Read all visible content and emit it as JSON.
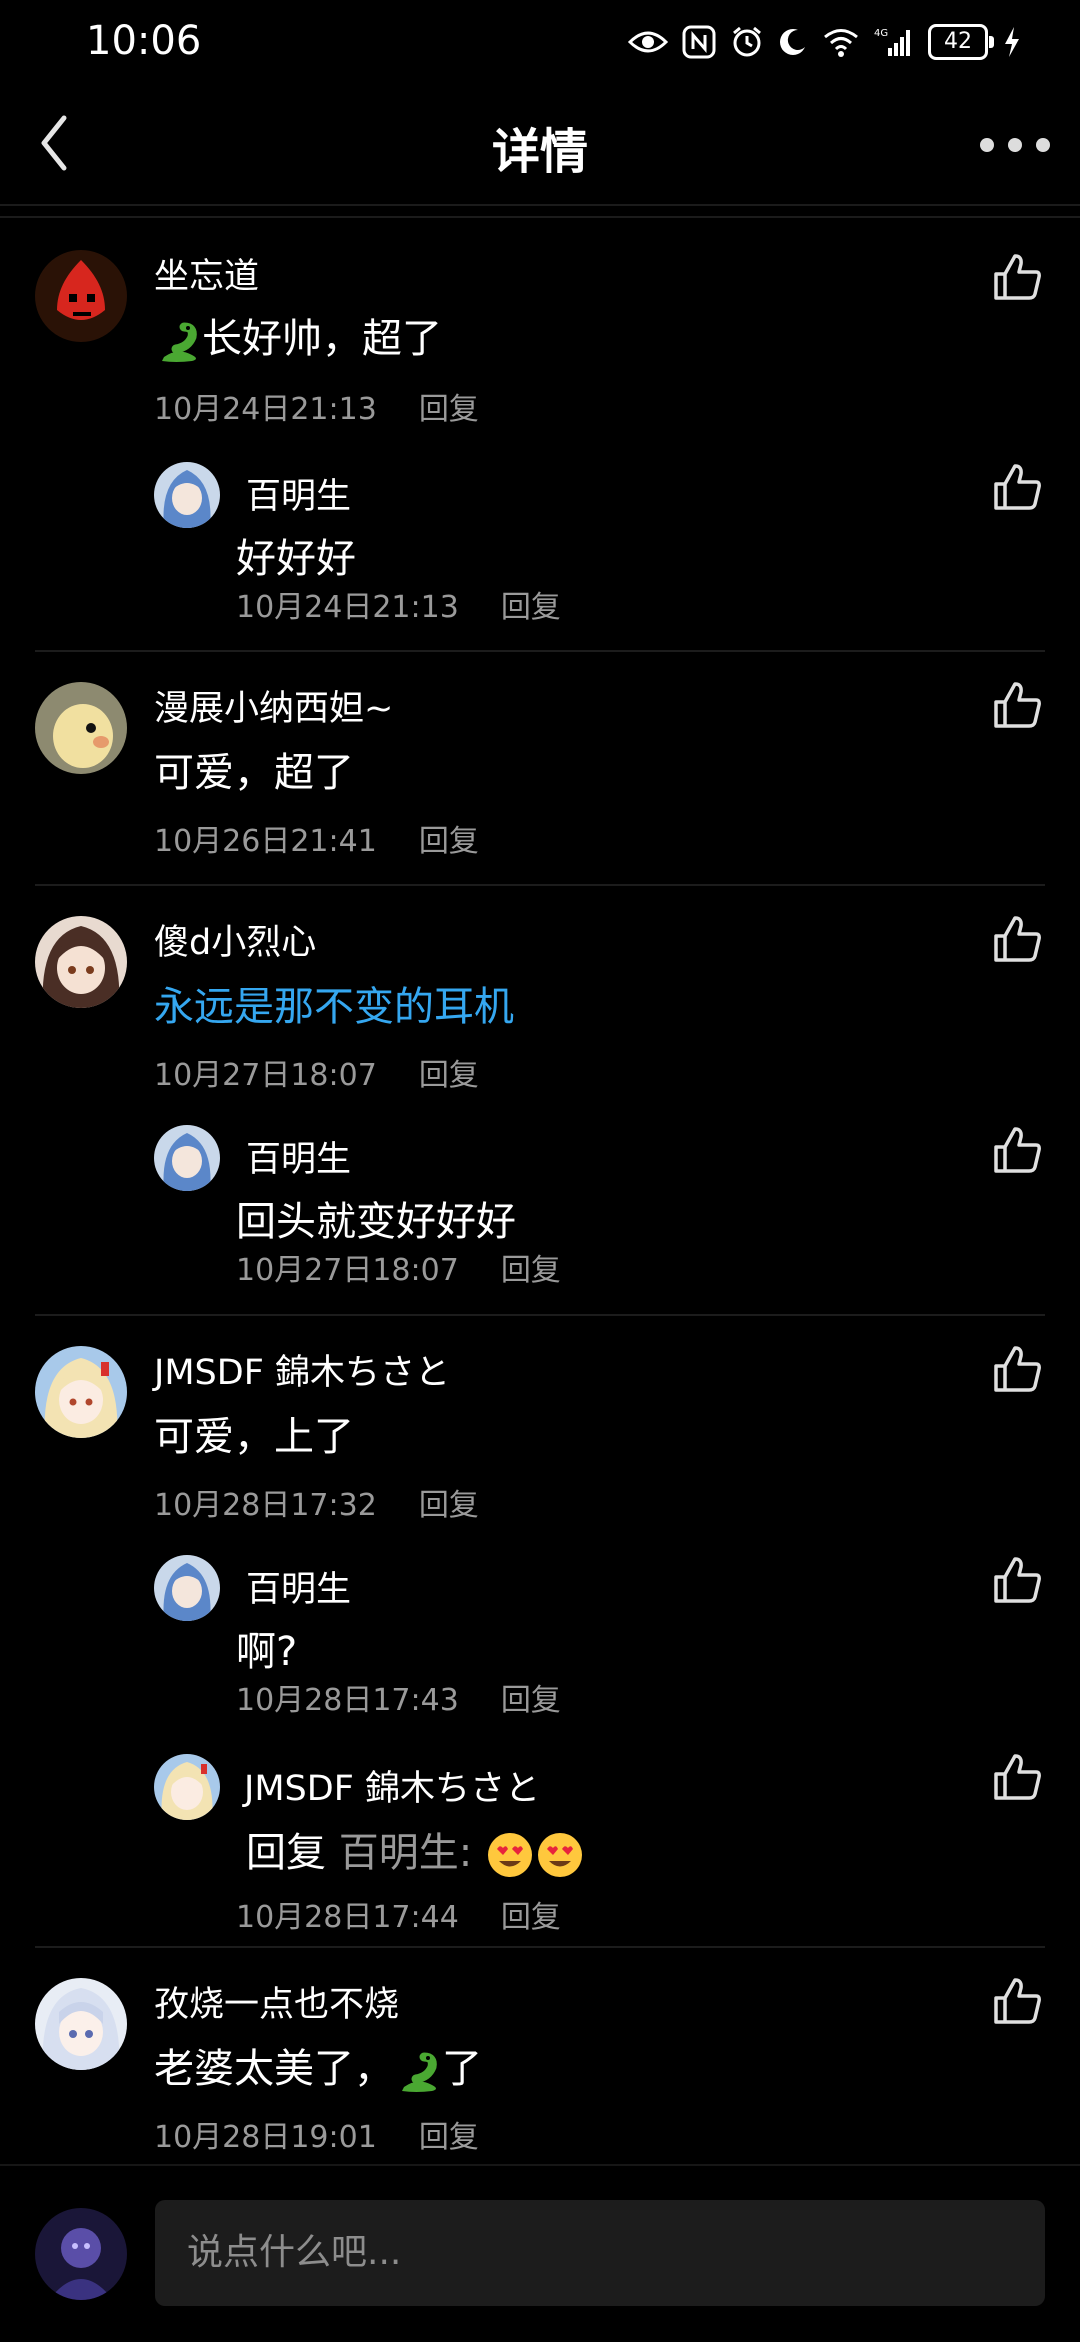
{
  "status_bar": {
    "time": "10:06",
    "battery": "42"
  },
  "nav": {
    "title": "详情"
  },
  "comments": [
    {
      "name": "坐忘道",
      "text": "长好帅，超了",
      "date": "10月24日21:13",
      "reply": "回复"
    },
    {
      "name": "百明生",
      "text": "好好好",
      "date": "10月24日21:13",
      "reply": "回复"
    },
    {
      "name": "漫展小纳西妲~",
      "text": "可爱，超了",
      "date": "10月26日21:41",
      "reply": "回复"
    },
    {
      "name": "傻d小烈心",
      "text": "永远是那不变的耳机",
      "date": "10月27日18:07",
      "reply": "回复"
    },
    {
      "name": "百明生",
      "text": "回头就变好好好",
      "date": "10月27日18:07",
      "reply": "回复"
    },
    {
      "name": "JMSDF 錦木ちさと",
      "text": "可爱，上了",
      "date": "10月28日17:32",
      "reply": "回复"
    },
    {
      "name": "百明生",
      "text": "啊?",
      "date": "10月28日17:43",
      "reply": "回复"
    },
    {
      "name": "JMSDF 錦木ちさと",
      "text_prefix": "回复",
      "text_target": "百明生:",
      "date": "10月28日17:44",
      "reply": "回复"
    },
    {
      "name": "孜烧一点也不烧",
      "text_a": "老婆太美了，",
      "text_b": "了",
      "date": "10月28日19:01",
      "reply": "回复"
    }
  ],
  "input": {
    "placeholder": "说点什么吧..."
  },
  "icons": [
    "back-arrow-icon",
    "more-icon",
    "like-icon",
    "snake-emoji",
    "heart-eyes-emoji",
    "eye-icon",
    "nfc-icon",
    "alarm-icon",
    "moon-icon",
    "wifi-icon",
    "signal-icon",
    "battery-icon",
    "charging-icon"
  ],
  "colors": {
    "background": "#000000",
    "meta_gray": "#9a9a9a",
    "link_blue": "#35a7f0",
    "input_bg": "#1c1c1c"
  }
}
